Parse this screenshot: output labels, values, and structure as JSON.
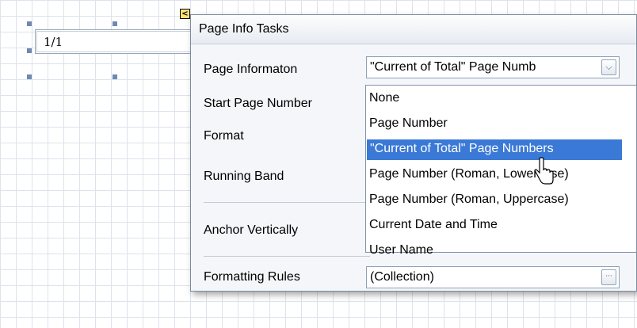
{
  "design_surface": {
    "label_text": "1/1"
  },
  "smart_tag": {
    "glyph": "<",
    "icon": "smart-tag-collapse-icon"
  },
  "panel": {
    "title": "Page Info Tasks",
    "properties": [
      {
        "label": "Page Informaton"
      },
      {
        "label": "Start Page Number"
      },
      {
        "label": "Format"
      },
      {
        "label": "Running Band"
      },
      {
        "label": "Anchor Vertically"
      },
      {
        "label": "Formatting Rules"
      }
    ],
    "page_information_value": "\"Current of Total\" Page Numb",
    "formatting_rules_value": "(Collection)",
    "combo_arrow_glyph": "⌵",
    "ellipsis_glyph": "···"
  },
  "dropdown": {
    "options": [
      "None",
      "Page Number",
      "\"Current of Total\" Page Numbers",
      "Page Number (Roman, Lowercase)",
      "Page Number (Roman, Uppercase)",
      "Current Date and Time",
      "User Name"
    ],
    "selected_index": 2
  },
  "colors": {
    "selection": "#3a79d6",
    "grid_line": "#dde3ec",
    "smart_tag": "#ffe17a",
    "panel_background": "#f4f6f9"
  }
}
